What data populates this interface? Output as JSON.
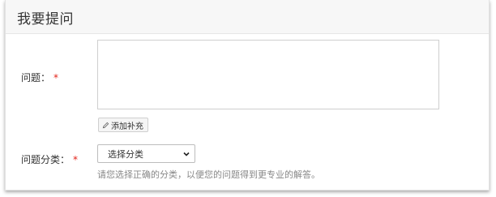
{
  "header": {
    "title": "我要提问"
  },
  "form": {
    "question_label": "问题：",
    "question_required": "*",
    "question_value": "",
    "add_supplement_label": "添加补充",
    "category_label": "问题分类：",
    "category_required": "*",
    "category_selected": "选择分类",
    "category_hint": "请您选择正确的分类，以便您的问题得到更专业的解答。"
  },
  "colors": {
    "required": "#e2231a",
    "header_bg": "#f7f7f7",
    "hint_text": "#888888"
  },
  "icons": {
    "add_supplement": "pencil-icon",
    "dropdown": "chevron-down-icon"
  }
}
